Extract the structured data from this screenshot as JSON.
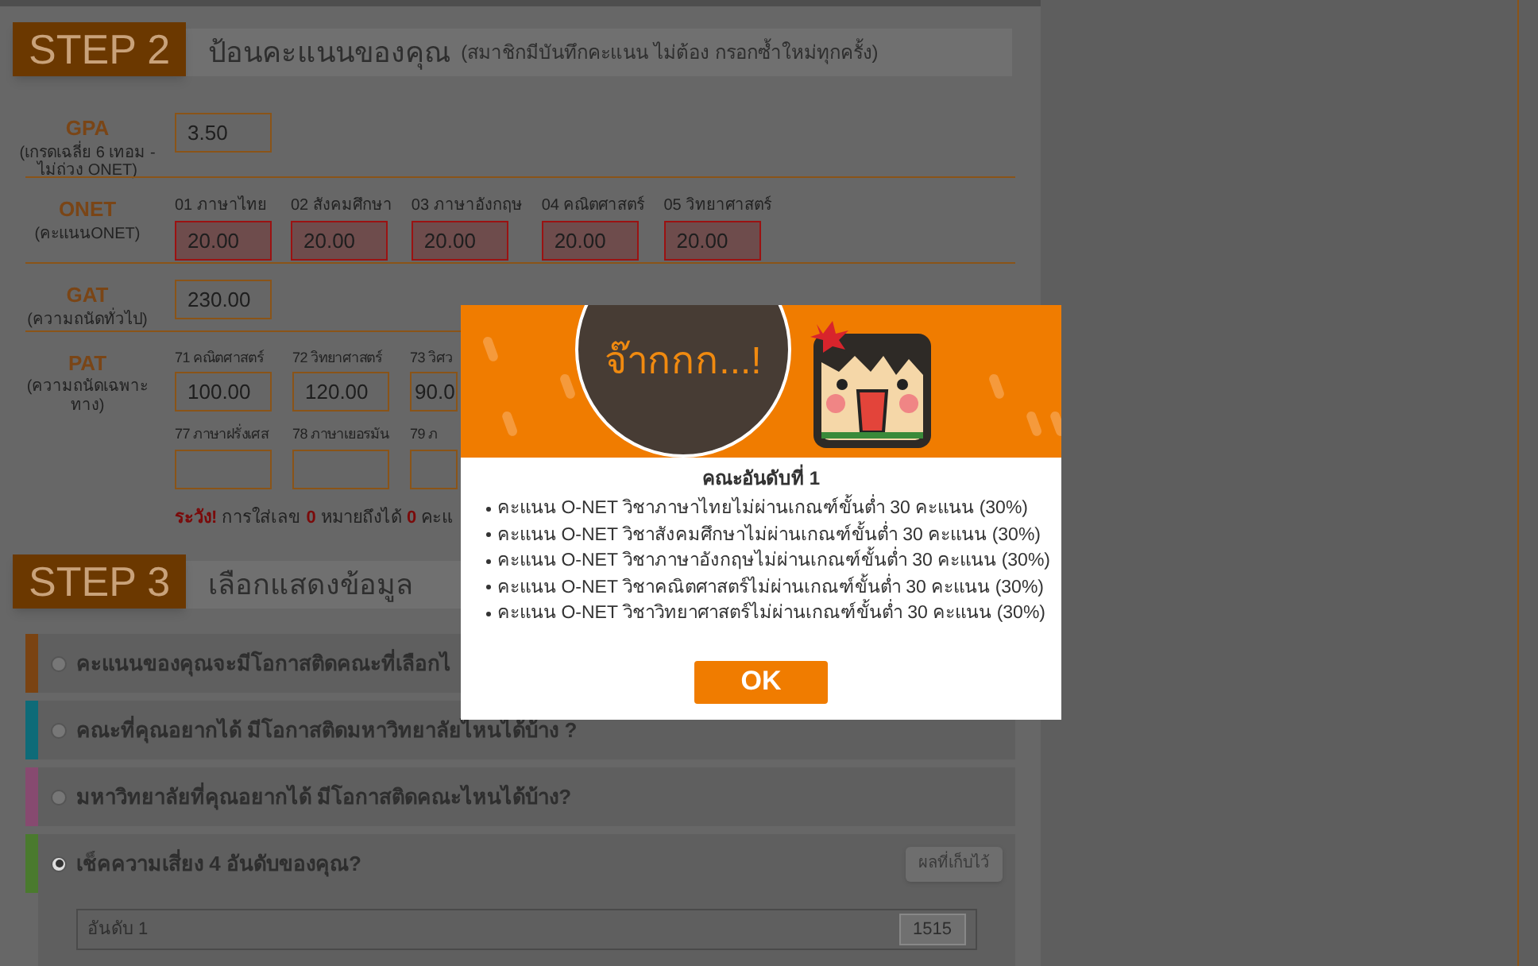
{
  "step2": {
    "badge": "STEP 2",
    "title": "ป้อนคะแนนของคุณ",
    "subtitle": "(สมาชิกมีบันทึกคะแนน ไม่ต้อง กรอกซ้ำใหม่ทุกครั้ง)"
  },
  "gpa": {
    "label": "GPA",
    "note": "(เกรดเฉลี่ย 6 เทอม - ไม่ถ่วง ONET)",
    "value": "3.50"
  },
  "onet": {
    "label": "ONET",
    "note": "(คะแนนONET)",
    "fields": [
      {
        "label": "01 ภาษาไทย",
        "value": "20.00",
        "failed": true
      },
      {
        "label": "02 สังคมศึกษา",
        "value": "20.00",
        "failed": true
      },
      {
        "label": "03 ภาษาอังกฤษ",
        "value": "20.00",
        "failed": true
      },
      {
        "label": "04 คณิตศาสตร์",
        "value": "20.00",
        "failed": true
      },
      {
        "label": "05 วิทยาศาสตร์",
        "value": "20.00",
        "failed": true
      }
    ]
  },
  "gat": {
    "label": "GAT",
    "note": "(ความถนัดทั่วไป)",
    "value": "230.00"
  },
  "pat": {
    "label": "PAT",
    "note": "(ความถนัดเฉพาะทาง)",
    "rows": [
      [
        {
          "label": "71 คณิตศาสตร์",
          "value": "100.00"
        },
        {
          "label": "72 วิทยาศาสตร์",
          "value": "120.00"
        },
        {
          "label": "73 วิศว",
          "value": "90.0"
        }
      ],
      [
        {
          "label": "77 ภาษาฝรั่งเศส"
        },
        {
          "label": "78 ภาษาเยอรมัน"
        },
        {
          "label": "79 ภ"
        }
      ]
    ]
  },
  "warning": "**ระวัง!** การใส่เลข **0** หมายถึงได้ **0** คะแ",
  "step3": {
    "badge": "STEP 3",
    "title": "เลือกแสดงข้อมูล"
  },
  "options": [
    {
      "text": "คะแนนของคุณจะมีโอกาสติดคณะที่เลือกไ",
      "selected": false,
      "color": "#7a4312"
    },
    {
      "text": "คณะที่คุณอยากได้ มีโอกาสติดมหาวิทยาลัยไหนได้บ้าง ?",
      "selected": false,
      "color": "#0e6b78"
    },
    {
      "text": "มหาวิทยาลัยที่คุณอยากได้ มีโอกาสติดคณะไหนได้บ้าง?",
      "selected": false,
      "color": "#874a70"
    },
    {
      "text": "เช็คความเสี่ยง 4 อันดับของคุณ?",
      "selected": true,
      "color": "#4a7a2e",
      "button": "ผลที่เก็บไว้",
      "rank": {
        "label": "อันดับ 1",
        "value": "1515"
      }
    }
  ],
  "modal": {
    "banner": "จ๊ากกก...!",
    "heading": "คณะอันดับที่ 1",
    "items": [
      "คะแนน O-NET วิชาภาษาไทยไม่ผ่านเกณฑ์ขั้นต่ำ 30 คะแนน (30%)",
      "คะแนน O-NET วิชาสังคมศึกษาไม่ผ่านเกณฑ์ขั้นต่ำ 30 คะแนน (30%)",
      "คะแนน O-NET วิชาภาษาอังกฤษไม่ผ่านเกณฑ์ขั้นต่ำ 30 คะแนน (30%)",
      "คะแนน O-NET วิชาคณิตศาสตร์ไม่ผ่านเกณฑ์ขั้นต่ำ 30 คะแนน (30%)",
      "คะแนน O-NET วิชาวิทยาศาสตร์ไม่ผ่านเกณฑ์ขั้นต่ำ 30 คะแนน (30%)"
    ],
    "button": "OK"
  }
}
